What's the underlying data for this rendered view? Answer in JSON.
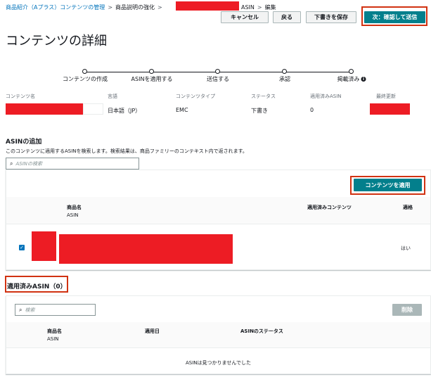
{
  "breadcrumb": {
    "items": [
      "商品紹介（Aプラス）コンテンツの管理",
      "商品説明の強化",
      "ASIN",
      "編集"
    ],
    "separator": ">"
  },
  "header": {
    "title": "コンテンツの詳細",
    "buttons": {
      "cancel": "キャンセル",
      "back": "戻る",
      "save_draft": "下書きを保存",
      "next": "次：確認して送信"
    }
  },
  "progress": {
    "steps": [
      "コンテンツの作成",
      "ASINを適用する",
      "送信する",
      "承認",
      "掲載済み"
    ],
    "info_glyph": "i"
  },
  "content_meta": {
    "headers": [
      "コンテンツ名",
      "言語",
      "コンテンツタイプ",
      "ステータス",
      "適用済みASIN",
      "最終更新"
    ],
    "language": "日本語（JP）",
    "content_type": "EMC",
    "status": "下書き",
    "applied_asin_count": "0"
  },
  "add_asin": {
    "title": "ASINの追加",
    "description": "このコンテンツに適用するASINを検索します。検索結果は、商品ファミリーのコンテキスト内で返されます。",
    "search_placeholder": "ASINの検索",
    "apply_button": "コンテンツを適用",
    "columns": {
      "product_name": "商品名",
      "asin": "ASIN",
      "applied_content": "適用済みコンテンツ",
      "eligible": "適格"
    },
    "rows": [
      {
        "checked": true,
        "eligible": "はい"
      }
    ]
  },
  "applied_asins": {
    "title": "適用済みASIN（0）",
    "search_placeholder": "検索",
    "delete_button": "削除",
    "columns": {
      "product_name": "商品名",
      "asin": "ASIN",
      "applied_date": "適用日",
      "asin_status": "ASINのステータス"
    },
    "empty_message": "ASINは見つかりませんでした"
  },
  "colors": {
    "primary": "#037f8c",
    "link": "#0073bb",
    "redaction": "#ed1c24",
    "highlight": "#d13212"
  },
  "icons": [
    "search-icon",
    "chevron-right-icon",
    "info-icon",
    "checkbox-checked-icon"
  ]
}
